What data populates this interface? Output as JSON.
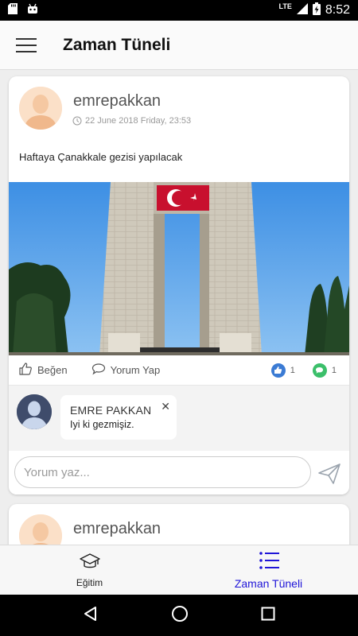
{
  "status_bar": {
    "time": "8:52",
    "network": "LTE",
    "icons": [
      "sd-card-icon",
      "android-icon",
      "signal-icon",
      "battery-icon"
    ]
  },
  "app_bar": {
    "title": "Zaman Tüneli",
    "menu_icon": "hamburger-menu-icon"
  },
  "posts": [
    {
      "author": "emrepakkan",
      "date": "22 June 2018 Friday, 23:53",
      "text": "Haftaya Çanakkale gezisi yapılacak",
      "image": "canakkale-martyrs-memorial-photo",
      "actions": {
        "like_label": "Beğen",
        "comment_label": "Yorum Yap"
      },
      "like_count": "1",
      "comment_count": "1",
      "comments": [
        {
          "name": "EMRE PAKKAN",
          "text": "Iyi ki gezmişiz."
        }
      ],
      "comment_input": {
        "placeholder": "Yorum yaz..."
      }
    },
    {
      "author": "emrepakkan"
    }
  ],
  "bottom_nav": {
    "items": [
      {
        "label": "Eğitim",
        "icon": "graduation-cap-icon",
        "active": false
      },
      {
        "label": "Zaman Tüneli",
        "icon": "timeline-list-icon",
        "active": true
      }
    ]
  },
  "colors": {
    "accent": "#1f15d8",
    "like_badge": "#3b7bd4",
    "comment_badge": "#3bbf6a",
    "avatar_bg": "#fbe0c8"
  }
}
